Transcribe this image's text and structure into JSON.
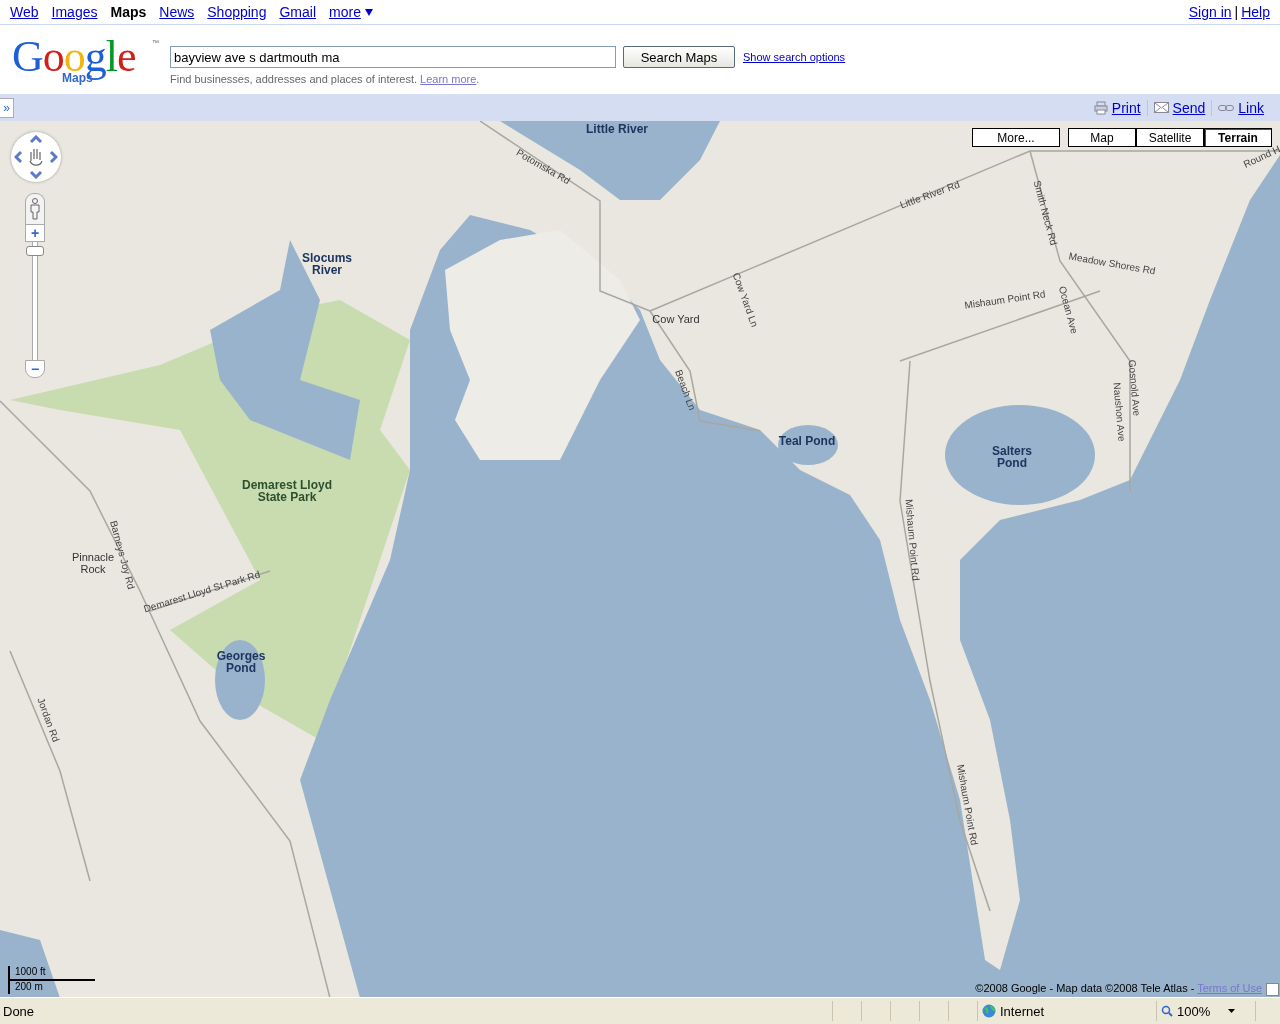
{
  "nav": {
    "links": [
      {
        "label": "Web",
        "selected": false
      },
      {
        "label": "Images",
        "selected": false
      },
      {
        "label": "Maps",
        "selected": true
      },
      {
        "label": "News",
        "selected": false
      },
      {
        "label": "Shopping",
        "selected": false
      },
      {
        "label": "Gmail",
        "selected": false
      },
      {
        "label": "more",
        "selected": false
      }
    ],
    "account": [
      "Sign in",
      "Help"
    ],
    "separator": "|"
  },
  "logo": {
    "text": "Google",
    "sub": "Maps",
    "tm": "™"
  },
  "search": {
    "value": "bayview ave s dartmouth ma",
    "button": "Search Maps",
    "options_link": "Show search options",
    "hint": "Find businesses, addresses and places of interest.",
    "learn_more": "Learn more",
    "hint_end": "."
  },
  "toolbar": {
    "expand": "»",
    "actions": [
      {
        "kind": "print",
        "label": "Print"
      },
      {
        "kind": "send",
        "label": "Send"
      },
      {
        "kind": "link",
        "label": "Link"
      }
    ]
  },
  "map": {
    "more_button": "More...",
    "types": [
      {
        "label": "Map",
        "selected": false
      },
      {
        "label": "Satellite",
        "selected": false
      },
      {
        "label": "Terrain",
        "selected": true
      }
    ],
    "zoom": {
      "level": 0.93,
      "in_label": "+",
      "out_label": "−"
    },
    "scale": {
      "imperial": "1000 ft",
      "metric": "200 m"
    },
    "copyright": "©2008 Google - Map data ©2008 Tele Atlas - ",
    "terms": "Terms of Use",
    "labels": [
      {
        "text": "Little River",
        "kind": "water"
      },
      {
        "text": "Slocums River",
        "kind": "water"
      },
      {
        "text": "Cow Yard",
        "kind": "place"
      },
      {
        "text": "Teal Pond",
        "kind": "water"
      },
      {
        "text": "Salters Pond",
        "kind": "water"
      },
      {
        "text": "Demarest Lloyd State Park",
        "kind": "park"
      },
      {
        "text": "Pinnacle Rock",
        "kind": "place"
      },
      {
        "text": "Georges Pond",
        "kind": "water"
      },
      {
        "text": "Potomska Rd",
        "kind": "road"
      },
      {
        "text": "Little River Rd",
        "kind": "road"
      },
      {
        "text": "Round H",
        "kind": "road"
      },
      {
        "text": "Smith Neck Rd",
        "kind": "road"
      },
      {
        "text": "Meadow Shores Rd",
        "kind": "road"
      },
      {
        "text": "Mishaum Point Rd",
        "kind": "road"
      },
      {
        "text": "Ocean Ave",
        "kind": "road"
      },
      {
        "text": "Gosnold Ave",
        "kind": "road"
      },
      {
        "text": "Naushon Ave",
        "kind": "road"
      },
      {
        "text": "Cow Yard Ln",
        "kind": "road"
      },
      {
        "text": "Beach Ln",
        "kind": "road"
      },
      {
        "text": "Mishaum Point Rd",
        "kind": "road"
      },
      {
        "text": "Mishaum Point Rd",
        "kind": "road"
      },
      {
        "text": "Barneys Joy Rd",
        "kind": "road"
      },
      {
        "text": "Demarest Lloyd St Park Rd",
        "kind": "road"
      },
      {
        "text": "Jordan Rd",
        "kind": "road"
      }
    ]
  },
  "status_bar": {
    "status": "Done",
    "zone": "Internet",
    "zoom": "100%"
  }
}
